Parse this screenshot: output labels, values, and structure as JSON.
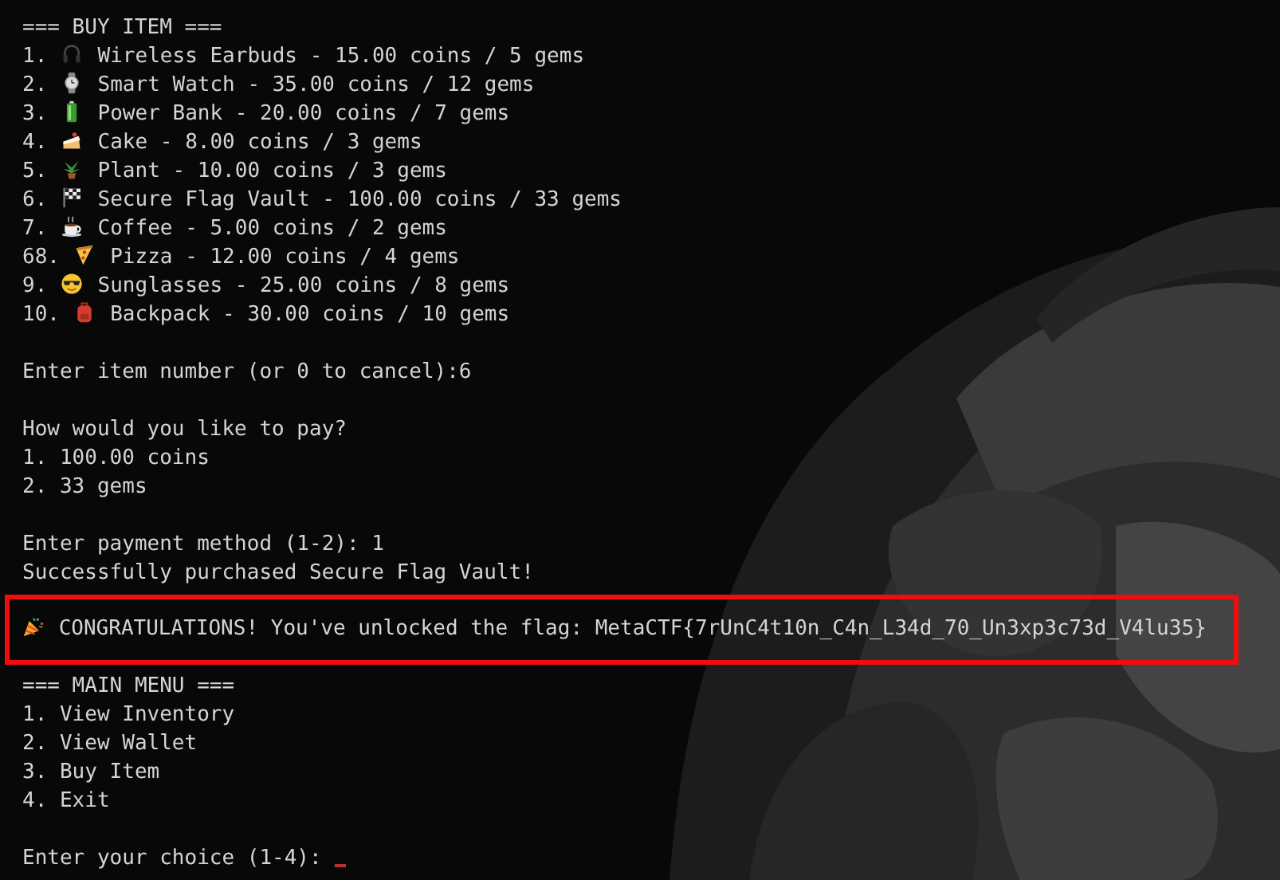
{
  "terminal": {
    "lines": [
      {
        "kind": "text",
        "text": "=== BUY ITEM ==="
      },
      {
        "kind": "item",
        "number": "1.",
        "text": "Wireless Earbuds - 15.00 coins / 5 gems"
      },
      {
        "kind": "item",
        "number": "2.",
        "text": "Smart Watch - 35.00 coins / 12 gems"
      },
      {
        "kind": "item",
        "number": "3.",
        "text": "Power Bank - 20.00 coins / 7 gems"
      },
      {
        "kind": "item",
        "number": "4.",
        "text": "Cake - 8.00 coins / 3 gems"
      },
      {
        "kind": "item",
        "number": "5.",
        "text": "Plant - 10.00 coins / 3 gems"
      },
      {
        "kind": "item",
        "number": "6.",
        "text": "Secure Flag Vault - 100.00 coins / 33 gems"
      },
      {
        "kind": "item",
        "number": "7.",
        "text": "Coffee - 5.00 coins / 2 gems"
      },
      {
        "kind": "item",
        "number": "68.",
        "text": "Pizza - 12.00 coins / 4 gems"
      },
      {
        "kind": "item",
        "number": "9.",
        "text": "Sunglasses - 25.00 coins / 8 gems"
      },
      {
        "kind": "item",
        "number": "10.",
        "text": "Backpack - 30.00 coins / 10 gems"
      },
      {
        "kind": "blank"
      },
      {
        "kind": "text",
        "text": "Enter item number (or 0 to cancel):6"
      },
      {
        "kind": "blank"
      },
      {
        "kind": "text",
        "text": "How would you like to pay?"
      },
      {
        "kind": "text",
        "text": "1. 100.00 coins"
      },
      {
        "kind": "text",
        "text": "2. 33 gems"
      },
      {
        "kind": "blank"
      },
      {
        "kind": "text",
        "text": "Enter payment method (1-2): 1"
      },
      {
        "kind": "text",
        "text": "Successfully purchased Secure Flag Vault!"
      },
      {
        "kind": "highlight",
        "text": "CONGRATULATIONS! You've unlocked the flag: MetaCTF{7rUnC4t10n_C4n_L34d_70_Un3xp3c73d_V4lu35}"
      },
      {
        "kind": "text",
        "text": "=== MAIN MENU ==="
      },
      {
        "kind": "text",
        "text": "1. View Inventory"
      },
      {
        "kind": "text",
        "text": "2. View Wallet"
      },
      {
        "kind": "text",
        "text": "3. Buy Item"
      },
      {
        "kind": "text",
        "text": "4. Exit"
      },
      {
        "kind": "blank"
      },
      {
        "kind": "prompt",
        "text": "Enter your choice (1-4):",
        "cursor": true
      }
    ]
  }
}
